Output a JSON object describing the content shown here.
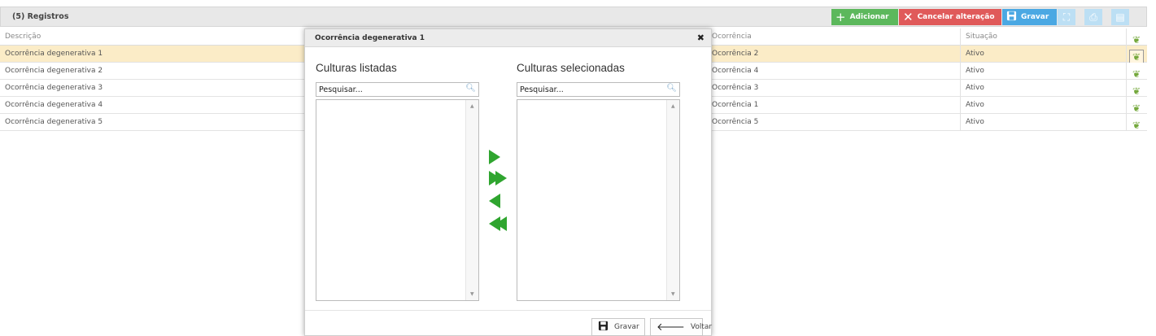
{
  "toolbar": {
    "title": "(5) Registros",
    "buttons": {
      "add": {
        "label": "Adicionar",
        "icon": "plus-icon"
      },
      "cancel": {
        "label": "Cancelar alteração",
        "icon": "close-icon"
      },
      "save": {
        "label": "Gravar",
        "icon": "floppy-icon"
      },
      "fullscreen": {
        "icon": "fullscreen-icon"
      },
      "print": {
        "icon": "print-icon"
      },
      "pdf": {
        "icon": "pdf-icon"
      }
    },
    "colors": {
      "add": "#5cb85c",
      "cancel": "#e05a5a",
      "save": "#4aa8e3"
    }
  },
  "table": {
    "columns": [
      "Descrição",
      "Ocorrência",
      "Situação"
    ],
    "rows": [
      {
        "descricao": "Ocorrência degenerativa 1",
        "ocorrencia": "Ocorrência 2",
        "situacao": "Ativo",
        "selected": true
      },
      {
        "descricao": "Ocorrência degenerativa 2",
        "ocorrencia": "Ocorrência 4",
        "situacao": "Ativo"
      },
      {
        "descricao": "Ocorrência degenerativa 3",
        "ocorrencia": "Ocorrência 3",
        "situacao": "Ativo"
      },
      {
        "descricao": "Ocorrência degenerativa 4",
        "ocorrencia": "Ocorrência 1",
        "situacao": "Ativo"
      },
      {
        "descricao": "Ocorrência degenerativa 5",
        "ocorrencia": "Ocorrência 5",
        "situacao": "Ativo"
      }
    ]
  },
  "modal": {
    "title": "Ocorrência degenerativa 1",
    "left": {
      "label": "Culturas listadas",
      "search_placeholder": "Pesquisar..."
    },
    "right": {
      "label": "Culturas selecionadas",
      "search_placeholder": "Pesquisar..."
    },
    "footer": {
      "save_label": "Gravar",
      "back_label": "Voltar"
    }
  }
}
